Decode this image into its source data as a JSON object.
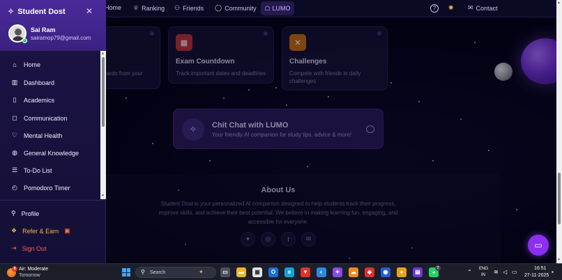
{
  "sidebar": {
    "brand": "Student Dost",
    "close_glyph": "✕",
    "user": {
      "name": "Sai Ram",
      "email": "sairamop79@gmail.com"
    },
    "menu": [
      {
        "label": "Home",
        "icon": "home-icon"
      },
      {
        "label": "Dashboard",
        "icon": "chart-icon"
      },
      {
        "label": "Academics",
        "icon": "book-icon"
      },
      {
        "label": "Communication",
        "icon": "message-icon"
      },
      {
        "label": "Mental Health",
        "icon": "heart-icon"
      },
      {
        "label": "General Knowledge",
        "icon": "globe-icon"
      },
      {
        "label": "To-Do List",
        "icon": "list-icon"
      },
      {
        "label": "Pomodoro Timer",
        "icon": "timer-icon"
      }
    ],
    "profile": "Profile",
    "refer": "Refer & Earn",
    "sign_out": "Sign Out",
    "accent_color": "#f5b83d",
    "signout_color": "#ff5a5a"
  },
  "topnav": {
    "home": "Home",
    "ranking": "Ranking",
    "friends": "Friends",
    "community": "Community",
    "lumo": "LUMO",
    "contact": "Contact"
  },
  "cards": [
    {
      "title": "",
      "desc": "cards from your"
    },
    {
      "title": "Exam Countdown",
      "desc": "Track important dates and deadlines",
      "icon": "calendar-icon",
      "color": "#b8323a"
    },
    {
      "title": "Challenges",
      "desc": "Compete with friends in daily challenges",
      "icon": "sword-icon",
      "color": "#c46a12"
    }
  ],
  "chit_chat": {
    "title": "Chit Chat with LUMO",
    "desc": "Your friendly AI companion for study tips, advice & more!"
  },
  "about": {
    "title": "About Us",
    "text": "Student Dost is your personalized AI companion designed to help students track their progress, improve skills, and achieve their best potential. We believe in making learning fun, engaging, and accessible for everyone.",
    "socials": [
      "twitter-icon",
      "instagram-icon",
      "facebook-icon",
      "mail-icon"
    ]
  },
  "taskbar": {
    "weather_title": "Air: Moderate",
    "weather_sub": "Tomorrow",
    "weather_badge": "8",
    "search": "Search",
    "lang1": "ENG",
    "lang2": "IN",
    "time": "16:51",
    "date": "27-11-2025",
    "whatsapp_badge": "7"
  }
}
